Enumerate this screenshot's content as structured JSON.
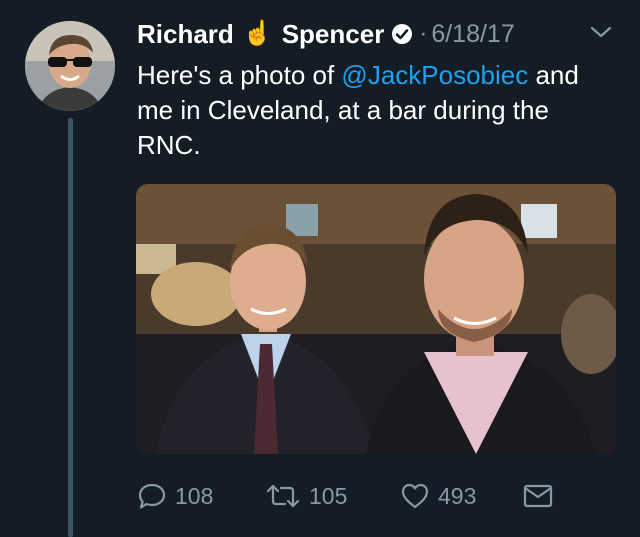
{
  "tweet": {
    "author_first": "Richard",
    "author_emoji": "☝️",
    "author_last": "Spencer",
    "separator": "·",
    "date": "6/18/17",
    "text_before": "Here's a photo of ",
    "mention": "@JackPosobiec",
    "text_after": " and me in Cleveland, at a bar during the RNC."
  },
  "actions": {
    "replies": "108",
    "retweets": "105",
    "likes": "493"
  },
  "icons": {
    "verified": "verified-badge-icon",
    "menu": "chevron-down-icon",
    "reply": "reply-icon",
    "retweet": "retweet-icon",
    "like": "heart-icon",
    "dm": "envelope-icon"
  },
  "colors": {
    "background": "#141d26",
    "link": "#1da1f2",
    "muted": "#8899a6",
    "thread_line": "#3d5466"
  }
}
